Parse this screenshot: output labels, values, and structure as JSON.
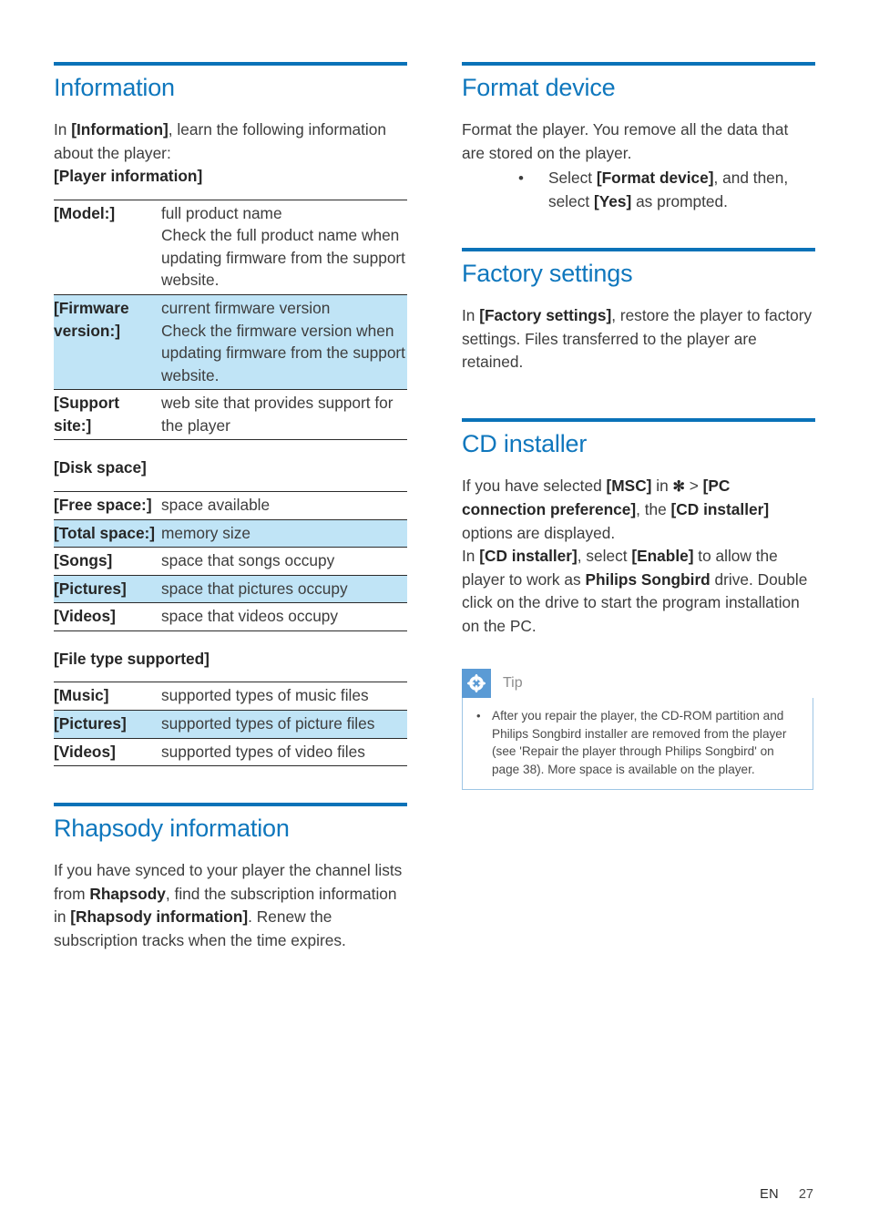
{
  "page": {
    "language_code": "EN",
    "page_number": "27",
    "accent_color": "#0f77bd",
    "rule_color": "#0a72b8",
    "row_highlight_color": "#c0e4f6",
    "tip_icon_color": "#5b9bd5"
  },
  "left_column": {
    "information": {
      "heading": "Information",
      "intro_prefix": "In ",
      "intro_bold": "[Information]",
      "intro_suffix": ", learn the following information about the player:",
      "player_information_label": "[Player information]",
      "player_table": [
        {
          "key": "[Model:]",
          "value": "full product name\nCheck the full product name when updating firmware from the support website.",
          "highlight": false
        },
        {
          "key": "[Firmware version:]",
          "value": "current firmware version\nCheck the firmware version when updating firmware from the support website.",
          "highlight": true
        },
        {
          "key": "[Support site:]",
          "value": "web site that provides support for the player",
          "highlight": false
        }
      ],
      "disk_space_label": "[Disk space]",
      "disk_space_table": [
        {
          "key": "[Free space:]",
          "value": "space available",
          "highlight": false
        },
        {
          "key": "[Total space:]",
          "value": "memory size",
          "highlight": true
        },
        {
          "key": "[Songs]",
          "value": "space that songs occupy",
          "highlight": false
        },
        {
          "key": "[Pictures]",
          "value": "space that pictures occupy",
          "highlight": true
        },
        {
          "key": "[Videos]",
          "value": "space that videos occupy",
          "highlight": false
        }
      ],
      "file_type_label": "[File type supported]",
      "file_type_table": [
        {
          "key": "[Music]",
          "value": "supported types of music files",
          "highlight": false
        },
        {
          "key": "[Pictures]",
          "value": "supported types of picture files",
          "highlight": true
        },
        {
          "key": "[Videos]",
          "value": "supported types of video files",
          "highlight": false
        }
      ]
    },
    "rhapsody": {
      "heading": "Rhapsody information",
      "p1_a": "If you have synced to your player the channel lists from ",
      "p1_b": "Rhapsody",
      "p1_c": ", find the subscription information in ",
      "p1_d": "[Rhapsody information]",
      "p1_e": ". Renew the subscription tracks when the time expires."
    }
  },
  "right_column": {
    "format_device": {
      "heading": "Format device",
      "p1": "Format the player. You remove all the data that are stored on the player.",
      "bullet_a": "Select ",
      "bullet_b": "[Format device]",
      "bullet_c": ", and then, select ",
      "bullet_d": "[Yes]",
      "bullet_e": " as prompted."
    },
    "factory_settings": {
      "heading": "Factory settings",
      "p1_a": "In ",
      "p1_b": "[Factory settings]",
      "p1_c": ", restore the player to factory settings. Files transferred to the player are retained."
    },
    "cd_installer": {
      "heading": "CD installer",
      "p1_a": "If you have selected ",
      "p1_b": "[MSC]",
      "p1_c": " in ",
      "p1_gear": "✻",
      "p1_d": " > ",
      "p1_e": "[PC connection preference]",
      "p1_f": ", the ",
      "p1_g": "[CD installer]",
      "p1_h": " options are displayed.",
      "p2_a": "In ",
      "p2_b": "[CD installer]",
      "p2_c": ", select ",
      "p2_d": "[Enable]",
      "p2_e": " to allow the player to work as ",
      "p2_f": "Philips Songbird",
      "p2_g": " drive. Double click on the drive to start the program installation on the PC."
    },
    "tip": {
      "title": "Tip",
      "icon": "asterisk-flower-icon",
      "items": [
        "After you repair the player, the CD-ROM partition and Philips Songbird installer are removed from the player (see 'Repair the player through Philips Songbird' on page 38). More space is available on the player."
      ]
    }
  }
}
